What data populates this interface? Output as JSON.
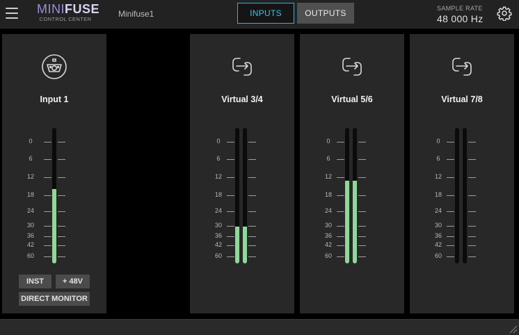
{
  "app": {
    "logo_mini": "MINI",
    "logo_fuse": "FUSE",
    "logo_sub": "CONTROL CENTER",
    "device_name": "Minifuse1"
  },
  "tabs": [
    {
      "label": "INPUTS",
      "active": true
    },
    {
      "label": "OUTPUTS",
      "active": false
    }
  ],
  "sample_rate": {
    "label": "SAMPLE RATE",
    "value": "48 000 Hz"
  },
  "icons": {
    "menu": "hamburger-menu-icon",
    "settings": "gear-icon",
    "input": "xlr-combo-jack-icon",
    "virtual": "loopback-arrows-icon",
    "resize": "resize-grip-icon"
  },
  "meter_scale": [
    "0",
    "6",
    "12",
    "18",
    "24",
    "30",
    "36",
    "42",
    "60"
  ],
  "colors": {
    "accent": "#29b7e6",
    "meter_fill": "#8fd89a",
    "panel": "#282828"
  },
  "channels": [
    {
      "name": "Input 1",
      "type": "input",
      "levels": [
        0.55
      ]
    },
    {
      "name": "Virtual 3/4",
      "type": "virtual",
      "levels": [
        0.27,
        0.27
      ]
    },
    {
      "name": "Virtual 5/6",
      "type": "virtual",
      "levels": [
        0.61,
        0.61
      ]
    },
    {
      "name": "Virtual 7/8",
      "type": "virtual",
      "levels": [
        0.0,
        0.0
      ]
    }
  ],
  "input_buttons": {
    "inst": "INST",
    "phantom": "+ 48V",
    "direct_monitor": "DIRECT MONITOR"
  }
}
